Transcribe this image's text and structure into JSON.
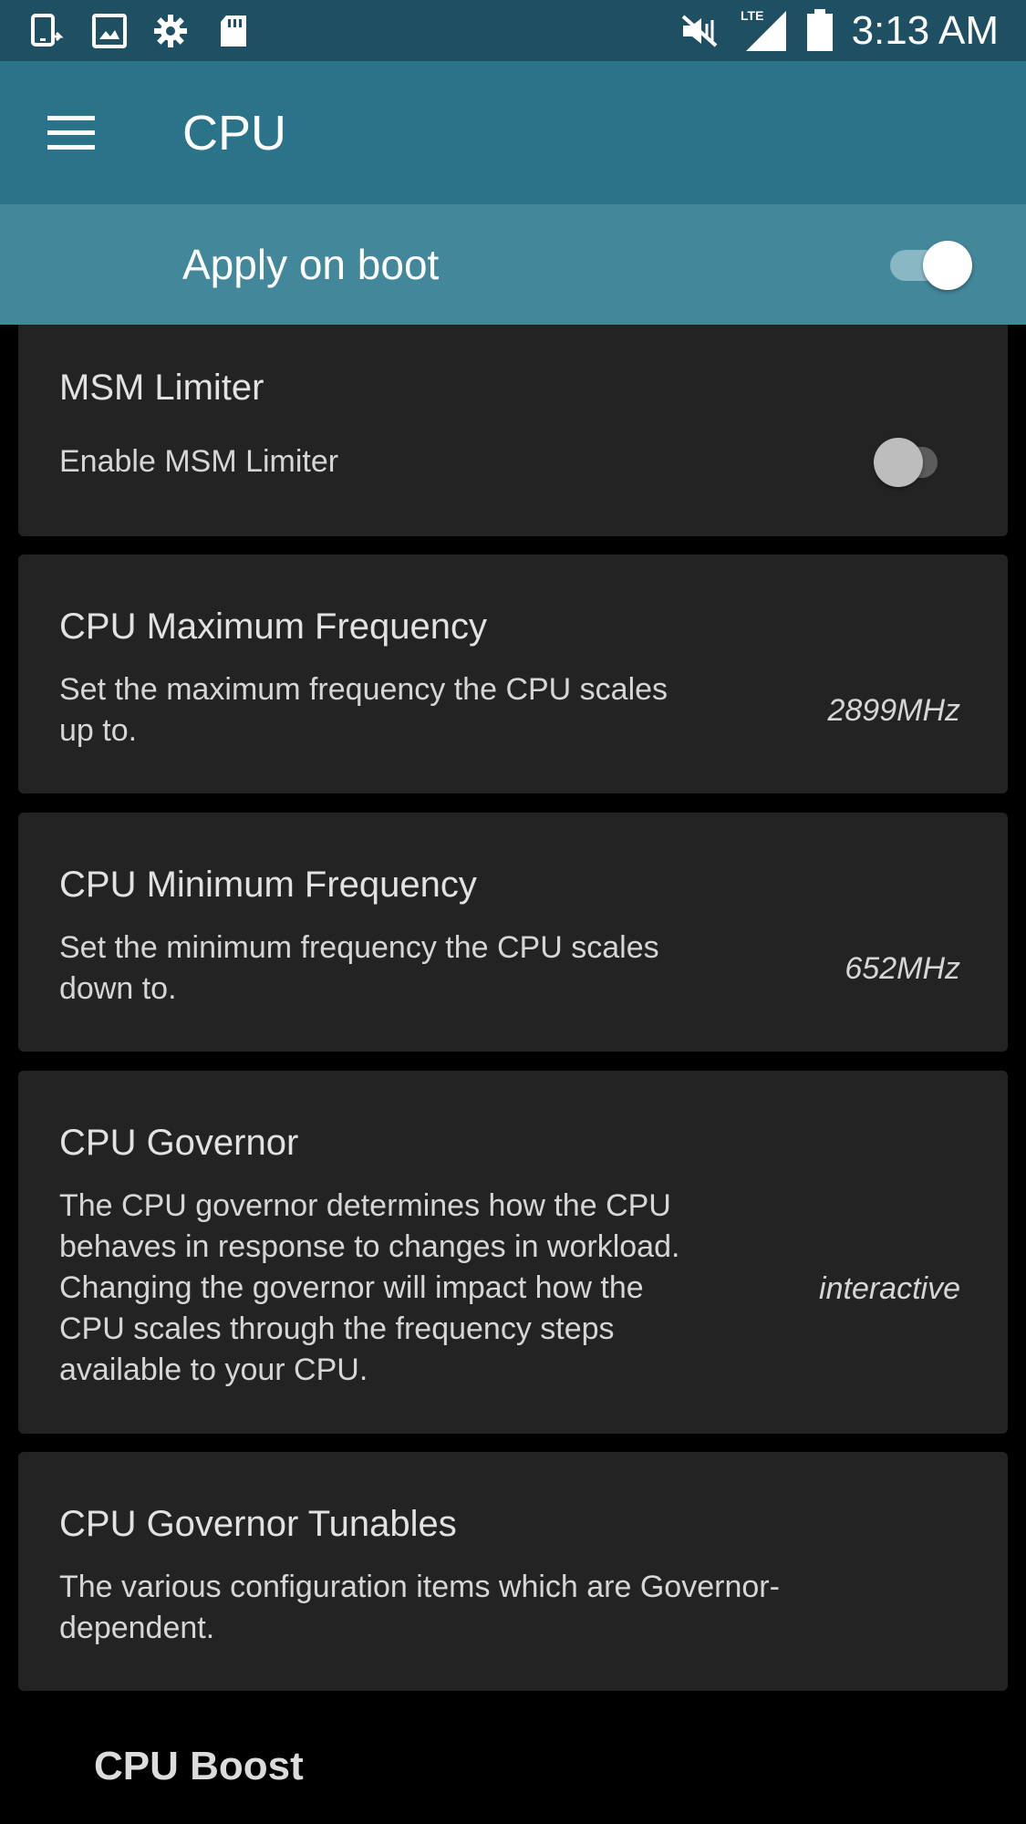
{
  "status_bar": {
    "time": "3:13 AM",
    "network": "LTE",
    "icons": [
      "tablet-rotate-icon",
      "image-icon",
      "gear-icon",
      "sd-card-icon",
      "mute-vibrate-icon",
      "lte-signal-icon",
      "battery-icon"
    ]
  },
  "app_bar": {
    "title": "CPU",
    "menu_icon": "hamburger-menu-icon"
  },
  "boot": {
    "label": "Apply on boot",
    "enabled": true
  },
  "msm_limiter": {
    "title": "MSM Limiter",
    "toggle_label": "Enable MSM Limiter",
    "enabled": false
  },
  "max_freq": {
    "title": "CPU Maximum Frequency",
    "description": "Set the maximum frequency the CPU scales up to.",
    "value": "2899MHz"
  },
  "min_freq": {
    "title": "CPU Minimum Frequency",
    "description": "Set the minimum frequency the CPU scales down to.",
    "value": "652MHz"
  },
  "governor": {
    "title": "CPU Governor",
    "description": "The CPU governor determines how the CPU behaves in response to changes in workload. Changing the governor will impact how the CPU scales through the frequency steps available to your CPU.",
    "value": "interactive"
  },
  "tunables": {
    "title": "CPU Governor Tunables",
    "description": "The various configuration items which are Governor-dependent."
  },
  "cpu_boost": {
    "header": "CPU Boost"
  },
  "colors": {
    "status_bar": "#1f4f62",
    "app_bar": "#2a7389",
    "boot_bar": "#43879b",
    "card": "#232323",
    "background": "#000000"
  }
}
